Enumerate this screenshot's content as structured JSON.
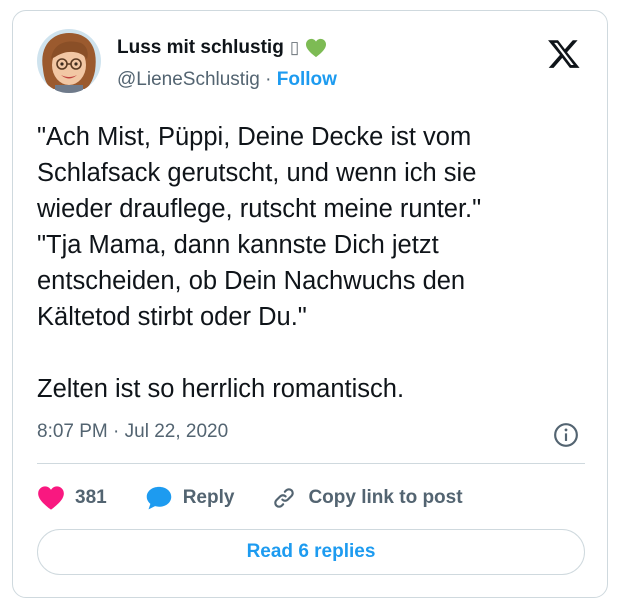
{
  "author": {
    "name": "Luss mit schlustig",
    "name_emoji": "▯",
    "handle": "@LieneSchlustig",
    "separator": "·",
    "follow_label": "Follow",
    "green_heart_color": "#7dbb54"
  },
  "tweet": {
    "lines": [
      "\"Ach Mist, Püppi, Deine Decke ist vom\nSchlafsack gerutscht, und wenn ich sie\nwieder drauflege, rutscht meine runter.\"\n\"Tja Mama, dann kannste Dich jetzt\nentscheiden, ob Dein Nachwuchs den\nKältetod stirbt oder Du.\"",
      "Zelten ist so herrlich romantisch."
    ],
    "timestamp": "8:07 PM · Jul 22, 2020"
  },
  "actions": {
    "likes": "381",
    "reply_label": "Reply",
    "copy_label": "Copy link to post",
    "like_color": "#f91880",
    "reply_color": "#1d9bf0"
  },
  "read_replies_label": "Read 6 replies",
  "icons": [
    "avatar",
    "x-logo-icon",
    "info-icon",
    "heart-icon",
    "reply-bubble-icon",
    "link-icon"
  ]
}
